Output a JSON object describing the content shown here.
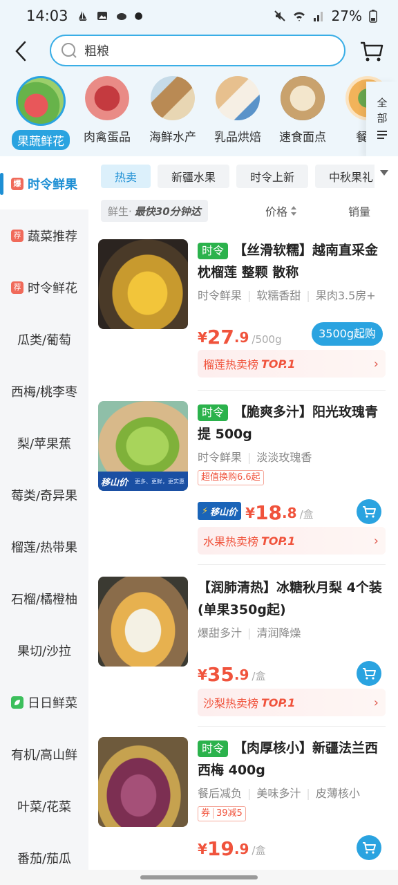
{
  "status": {
    "time": "14:03",
    "battery": "27%"
  },
  "search": {
    "placeholder": "粗粮"
  },
  "categories": [
    {
      "label": "果蔬鲜花"
    },
    {
      "label": "肉禽蛋品"
    },
    {
      "label": "海鲜水产"
    },
    {
      "label": "乳品烘焙"
    },
    {
      "label": "速食面点"
    },
    {
      "label": "餐饮"
    }
  ],
  "all_categories_label": [
    "全",
    "部"
  ],
  "sidebar": {
    "items": [
      {
        "tag": "爆",
        "label": "时令鲜果"
      },
      {
        "tag": "荐",
        "label": "蔬菜推荐"
      },
      {
        "tag": "荐",
        "label": "时令鲜花"
      },
      {
        "label": "瓜类/葡萄"
      },
      {
        "label": "西梅/桃李枣"
      },
      {
        "label": "梨/苹果蕉"
      },
      {
        "label": "莓类/奇异果"
      },
      {
        "label": "榴莲/热带果"
      },
      {
        "label": "石榴/橘橙柚"
      },
      {
        "label": "果切/沙拉"
      },
      {
        "label": "日日鲜菜"
      },
      {
        "label": "有机/高山鲜"
      },
      {
        "label": "叶菜/花菜"
      },
      {
        "label": "番茄/茄瓜"
      }
    ]
  },
  "subtabs": [
    "热卖",
    "新疆水果",
    "时令上新",
    "中秋果礼"
  ],
  "filter": {
    "fast_prefix": "鲜生·",
    "fast_text": "最快30分钟达",
    "price": "价格",
    "sales": "销量"
  },
  "products": [
    {
      "badge": "时令",
      "title": "【丝滑软糯】越南直采金枕榴莲 整颗 散称",
      "attrs": [
        "时令鲜果",
        "软糯香甜",
        "果肉3.5房+"
      ],
      "price_int": "27",
      "price_dec": ".9",
      "unit": "/500g",
      "buy_label": "3500g起购",
      "rank_text": "榴莲热卖榜",
      "rank_top": "TOP.1"
    },
    {
      "badge": "时令",
      "title": "【脆爽多汁】阳光玫瑰青提 500g",
      "attrs": [
        "时令鲜果",
        "淡淡玫瑰香"
      ],
      "promo": "超值换购6.6起",
      "img_tag": "移山价",
      "img_tag_sub": "更多、更鲜，更实惠",
      "price_tag": "移山价",
      "price_int": "18",
      "price_dec": ".8",
      "unit": "/盒",
      "rank_text": "水果热卖榜",
      "rank_top": "TOP.1"
    },
    {
      "title": "【润肺清热】冰糖秋月梨 4个装(单果350g起)",
      "attrs": [
        "爆甜多汁",
        "清润降燥"
      ],
      "price_int": "35",
      "price_dec": ".9",
      "unit": "/盒",
      "rank_text": "沙梨热卖榜",
      "rank_top": "TOP.1"
    },
    {
      "badge": "时令",
      "title": "【肉厚核小】新疆法兰西西梅 400g",
      "attrs": [
        "餐后减负",
        "美味多汁",
        "皮薄核小"
      ],
      "promo_tag": "券",
      "promo": "39减5",
      "price_int": "19",
      "price_dec": ".9",
      "unit": "/盒"
    }
  ],
  "colors": {
    "accent": "#2aa3e0",
    "price": "#f0533c",
    "season": "#2bb24c"
  }
}
